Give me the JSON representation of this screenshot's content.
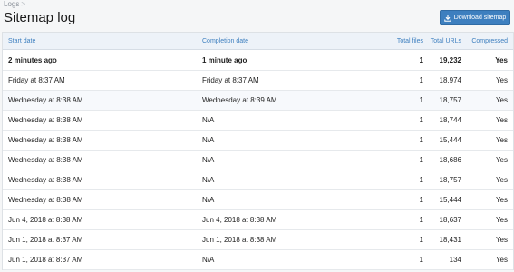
{
  "breadcrumb": {
    "item": "Logs",
    "separator": ">"
  },
  "page": {
    "title": "Sitemap log"
  },
  "toolbar": {
    "download_label": "Download sitemap"
  },
  "table": {
    "headers": {
      "start_date": "Start date",
      "completion_date": "Completion date",
      "total_files": "Total files",
      "total_urls": "Total URLs",
      "compressed": "Compressed"
    },
    "rows": [
      {
        "start": "2 minutes ago",
        "completion": "1 minute ago",
        "files": "1",
        "urls": "19,232",
        "compressed": "Yes"
      },
      {
        "start": "Friday at 8:37 AM",
        "completion": "Friday at 8:37 AM",
        "files": "1",
        "urls": "18,974",
        "compressed": "Yes"
      },
      {
        "start": "Wednesday at 8:38 AM",
        "completion": "Wednesday at 8:39 AM",
        "files": "1",
        "urls": "18,757",
        "compressed": "Yes"
      },
      {
        "start": "Wednesday at 8:38 AM",
        "completion": "N/A",
        "files": "1",
        "urls": "18,744",
        "compressed": "Yes"
      },
      {
        "start": "Wednesday at 8:38 AM",
        "completion": "N/A",
        "files": "1",
        "urls": "15,444",
        "compressed": "Yes"
      },
      {
        "start": "Wednesday at 8:38 AM",
        "completion": "N/A",
        "files": "1",
        "urls": "18,686",
        "compressed": "Yes"
      },
      {
        "start": "Wednesday at 8:38 AM",
        "completion": "N/A",
        "files": "1",
        "urls": "18,757",
        "compressed": "Yes"
      },
      {
        "start": "Wednesday at 8:38 AM",
        "completion": "N/A",
        "files": "1",
        "urls": "15,444",
        "compressed": "Yes"
      },
      {
        "start": "Jun 4, 2018 at 8:38 AM",
        "completion": "Jun 4, 2018 at 8:38 AM",
        "files": "1",
        "urls": "18,637",
        "compressed": "Yes"
      },
      {
        "start": "Jun 1, 2018 at 8:37 AM",
        "completion": "Jun 1, 2018 at 8:38 AM",
        "files": "1",
        "urls": "18,431",
        "compressed": "Yes"
      },
      {
        "start": "Jun 1, 2018 at 8:37 AM",
        "completion": "N/A",
        "files": "1",
        "urls": "134",
        "compressed": "Yes"
      }
    ]
  },
  "colors": {
    "accent": "#3d7fbf",
    "header_bg": "#edf2f8",
    "page_bg": "#f5f6f7"
  },
  "icons": {
    "download": "download-icon"
  }
}
